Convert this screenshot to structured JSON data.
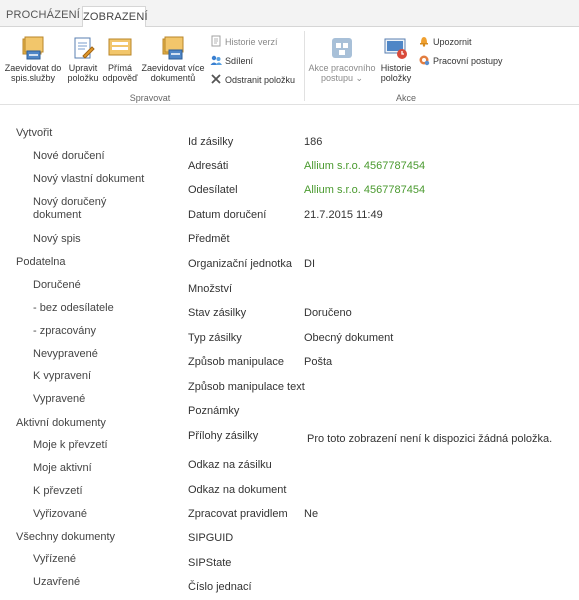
{
  "tabs": {
    "browse": "PROCHÁZENÍ",
    "view": "ZOBRAZENÍ"
  },
  "ribbon": {
    "group_manage": {
      "label": "Spravovat",
      "buttons": {
        "file_to_folder": [
          "Zaevidovat do",
          "spis.služby"
        ],
        "edit_item": [
          "Upravit",
          "položku"
        ],
        "direct_answer": [
          "Přímá",
          "odpověď"
        ],
        "file_multiple": [
          "Zaevidovat více",
          "dokumentů"
        ]
      },
      "small": {
        "version_history": "Historie verzí",
        "share": "Sdílení",
        "delete_item": "Odstranit položku"
      }
    },
    "group_actions": {
      "label": "Akce",
      "buttons": {
        "workflows": [
          "Akce pracovního",
          "postupu ⌄"
        ],
        "item_history": [
          "Historie",
          "položky"
        ]
      },
      "small": {
        "alert": "Upozornit",
        "workflows_small": "Pracovní postupy"
      }
    }
  },
  "nav": [
    {
      "label": "Vytvořit",
      "level": 1
    },
    {
      "label": "Nové doručení",
      "level": 2
    },
    {
      "label": "Nový vlastní dokument",
      "level": 2
    },
    {
      "label": "Nový doručený",
      "level": 2
    },
    {
      "label": "dokument",
      "level": 2
    },
    {
      "label": "Nový spis",
      "level": 2
    },
    {
      "label": "Podatelna",
      "level": 1
    },
    {
      "label": "Doručené",
      "level": 2
    },
    {
      "label": "- bez odesílatele",
      "level": 2
    },
    {
      "label": "- zpracovány",
      "level": 2
    },
    {
      "label": "Nevypravené",
      "level": 2
    },
    {
      "label": "K vypravení",
      "level": 2
    },
    {
      "label": "Vypravené",
      "level": 2
    },
    {
      "label": "Aktivní dokumenty",
      "level": 1
    },
    {
      "label": "Moje k převzetí",
      "level": 2
    },
    {
      "label": "Moje aktivní",
      "level": 2
    },
    {
      "label": "K převzetí",
      "level": 2
    },
    {
      "label": "Vyřizované",
      "level": 2
    },
    {
      "label": "Všechny dokumenty",
      "level": 1
    },
    {
      "label": "Vyřízené",
      "level": 2
    },
    {
      "label": "Uzavřené",
      "level": 2
    }
  ],
  "properties": [
    {
      "label": "Id zásilky",
      "value": "186"
    },
    {
      "label": "Adresáti",
      "value": "Allium s.r.o. 4567787454",
      "link": true
    },
    {
      "label": "Odesílatel",
      "value": "Allium s.r.o. 4567787454",
      "link": true
    },
    {
      "label": "Datum doručení",
      "value": "21.7.2015 11:49"
    },
    {
      "label": "Předmět",
      "value": ""
    },
    {
      "label": "Organizační jednotka",
      "value": "DI"
    },
    {
      "label": "Množství",
      "value": ""
    },
    {
      "label": "Stav zásilky",
      "value": "Doručeno"
    },
    {
      "label": "Typ zásilky",
      "value": "Obecný dokument"
    },
    {
      "label": "Způsob manipulace",
      "value": "Pošta"
    },
    {
      "label": "Způsob manipulace text",
      "value": ""
    },
    {
      "label": "Poznámky",
      "value": ""
    },
    {
      "label": "Přílohy zásilky",
      "value": "",
      "note": "Pro toto zobrazení není k dispozici žádná položka."
    },
    {
      "label": "Odkaz na zásilku",
      "value": ""
    },
    {
      "label": "Odkaz na dokument",
      "value": ""
    },
    {
      "label": "Zpracovat pravidlem",
      "value": "Ne"
    },
    {
      "label": "SIPGUID",
      "value": ""
    },
    {
      "label": "SIPState",
      "value": ""
    },
    {
      "label": "Číslo jednací",
      "value": ""
    }
  ]
}
